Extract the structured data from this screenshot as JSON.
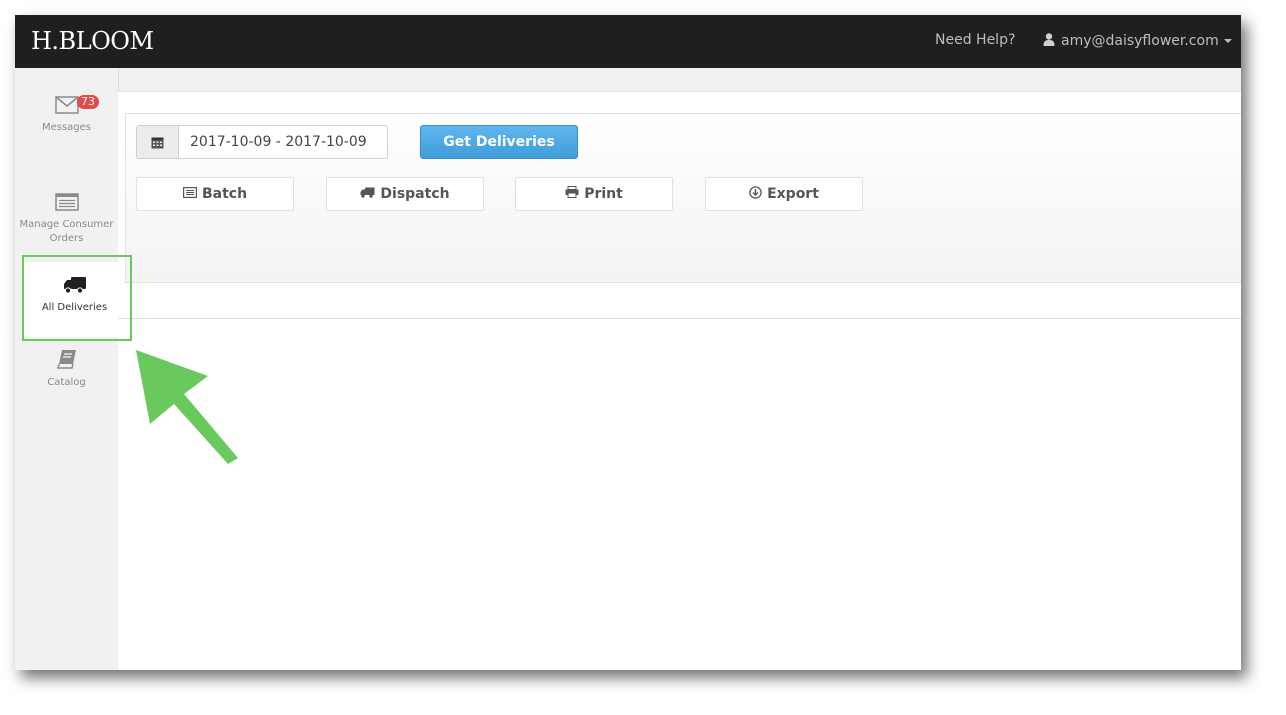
{
  "header": {
    "brand": "H.BLOOM",
    "help_label": "Need Help?",
    "user_email": "amy@daisyflower.com"
  },
  "sidebar": {
    "items": [
      {
        "label": "Messages",
        "icon": "envelope-icon",
        "badge": "73"
      },
      {
        "label": "Manage Consumer Orders",
        "icon": "list-icon"
      },
      {
        "label": "All Deliveries",
        "icon": "truck-icon",
        "active": true
      },
      {
        "label": "Catalog",
        "icon": "book-icon"
      }
    ]
  },
  "filters": {
    "date_range": "2017-10-09 - 2017-10-09",
    "calendar_icon": "calendar-icon",
    "get_deliveries_label": "Get Deliveries"
  },
  "actions": {
    "batch_label": "Batch",
    "dispatch_label": "Dispatch",
    "print_label": "Print",
    "export_label": "Export"
  },
  "colors": {
    "topbar": "#1f1f1f",
    "primary_button": "#4aa8e3",
    "badge": "#e04b4b",
    "callout_green": "#6ac95c"
  }
}
